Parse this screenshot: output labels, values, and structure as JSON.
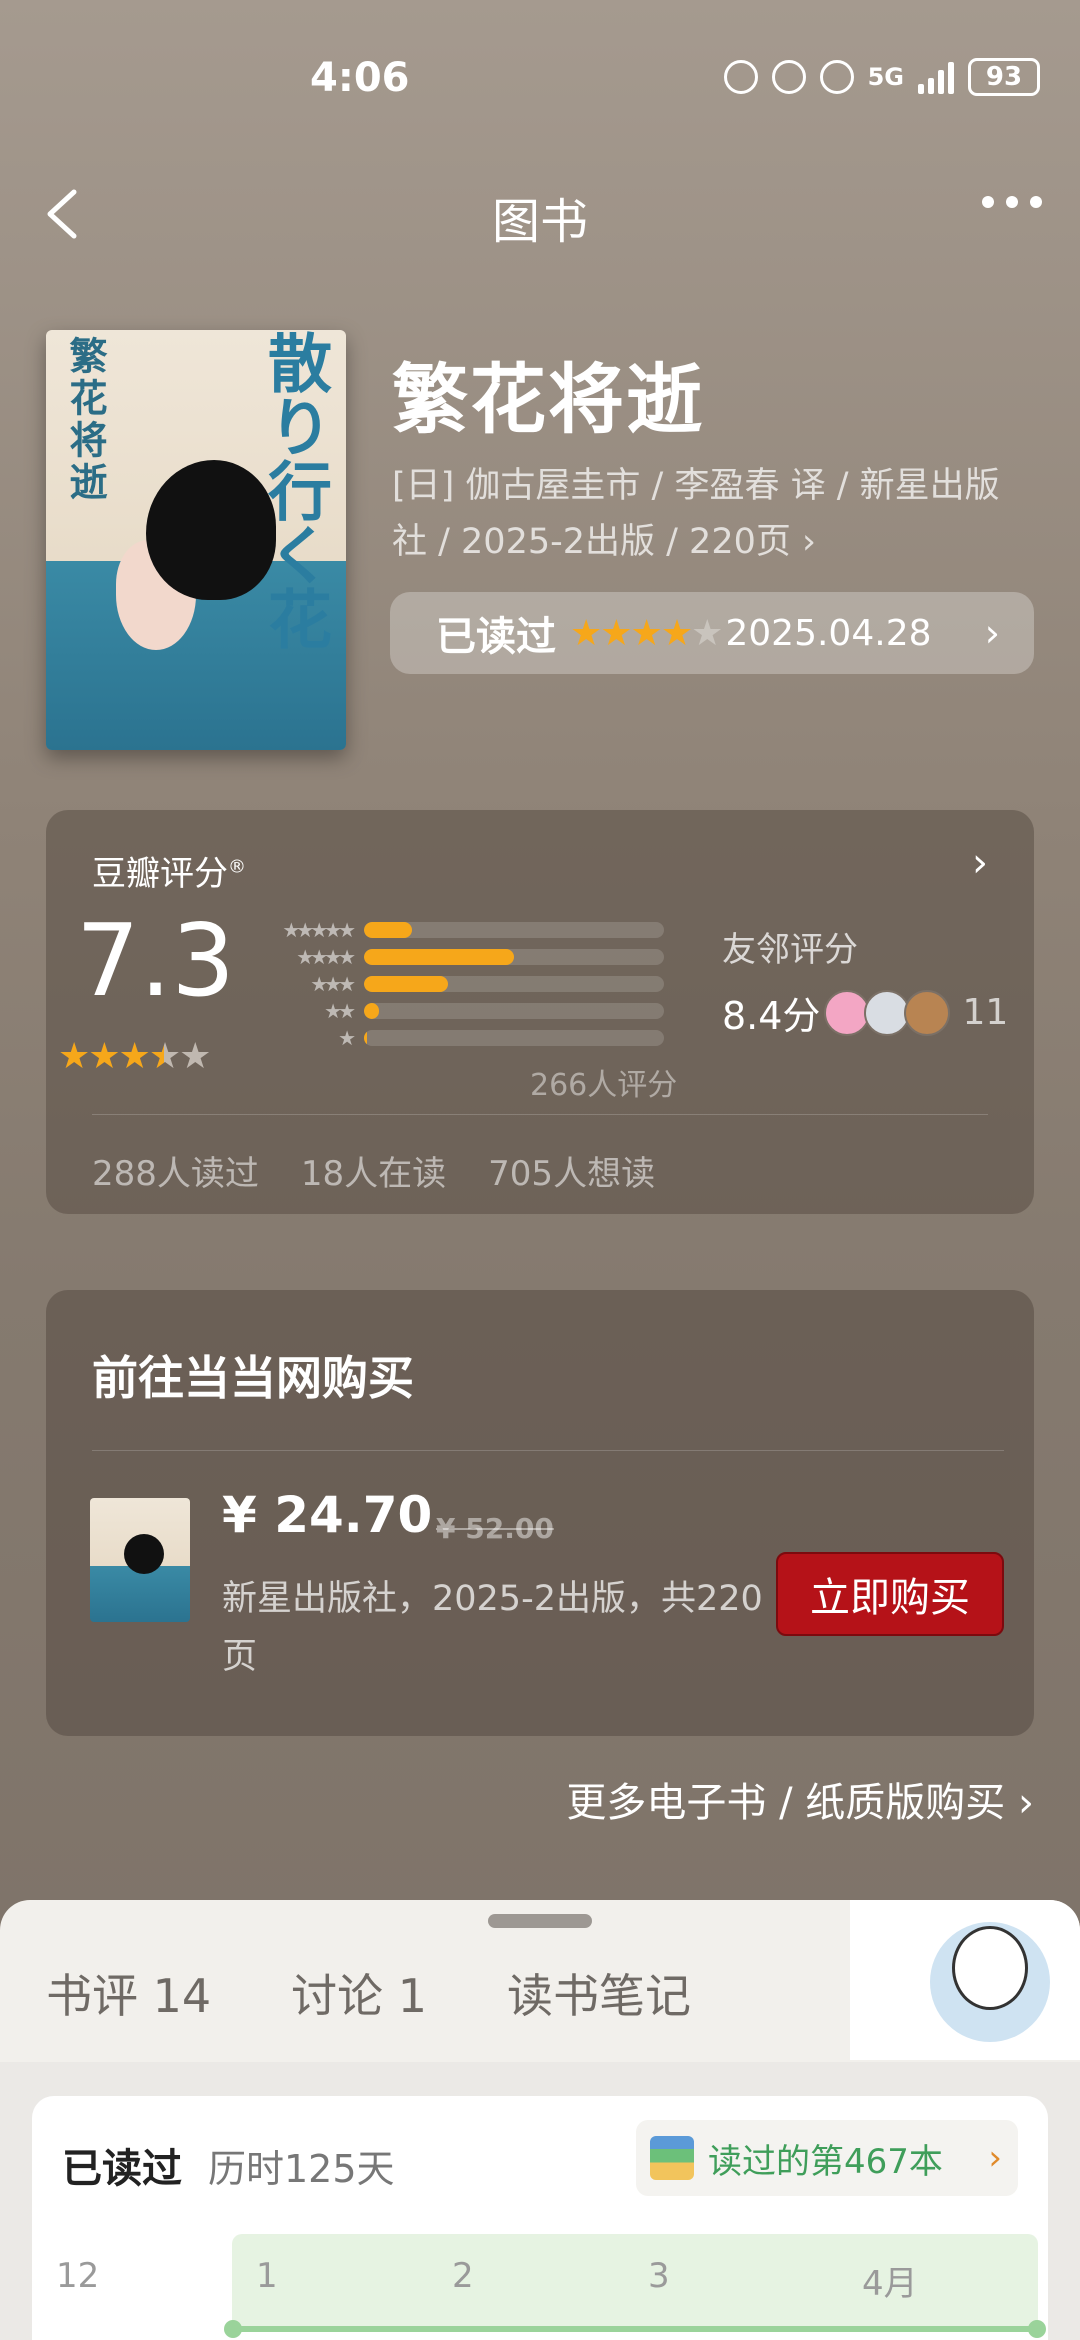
{
  "status_bar": {
    "time": "4:06",
    "battery": "93",
    "network": "5G"
  },
  "nav": {
    "title": "图书",
    "back_icon": "chevron-left-icon",
    "more_icon": "more-dots-icon"
  },
  "book": {
    "title": "繁花将逝",
    "meta": "[日] 伽古屋圭市 / 李盈春 译 / 新星出版社 / 2025-2出版 / 220页 ›",
    "cover_title_cn": "繁花将逝",
    "cover_title_jp": "散り行く花",
    "my_read": {
      "status": "已读过",
      "stars": 4,
      "date": "2025.04.28",
      "chevron": "›"
    }
  },
  "rating": {
    "label": "豆瓣评分",
    "mark": "®",
    "chevron": "›",
    "score": "7.3",
    "stars_value": 3.5,
    "distribution": [
      {
        "stars": "★★★★★",
        "fraction": 0.16
      },
      {
        "stars": "★★★★",
        "fraction": 0.5
      },
      {
        "stars": "★★★",
        "fraction": 0.28
      },
      {
        "stars": "★★",
        "fraction": 0.05
      },
      {
        "stars": "★",
        "fraction": 0.01
      }
    ],
    "count": "266人评分",
    "friends_label": "友邻评分",
    "friends_score": "8.4分",
    "friends_count": "11",
    "stats": [
      "288人读过",
      "18人在读",
      "705人想读"
    ]
  },
  "purchase": {
    "title": "前往当当网购买",
    "price": "¥ 24.70",
    "original_price": "¥ 52.00",
    "description": "新星出版社，2025-2出版，共220页",
    "button": "立即购买"
  },
  "more_link": "更多电子书 / 纸质版购买 ›",
  "sheet": {
    "tabs": [
      "书评 14",
      "讨论 1",
      "读书笔记"
    ],
    "read_status": "已读过",
    "duration": "历时125天",
    "badge": "读过的第467本",
    "badge_chevron": "›",
    "timeline_labels": [
      "12",
      "1",
      "2",
      "3",
      "4月"
    ]
  },
  "colors": {
    "accent_star": "#f6a71a",
    "buy_button": "#b51218",
    "badge_text": "#3f9e5a"
  }
}
